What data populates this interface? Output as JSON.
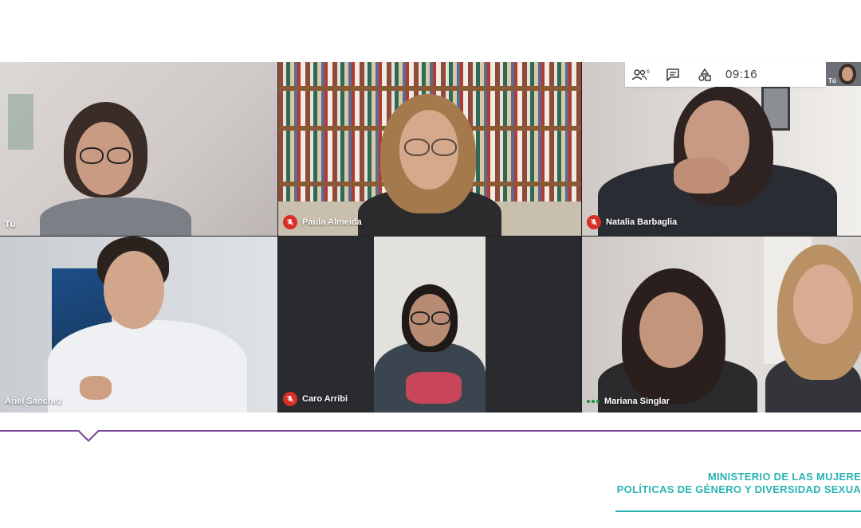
{
  "meeting": {
    "clock": "09:16",
    "self_label": "Tú"
  },
  "toolbar": {
    "people_badge": "6",
    "icons": [
      "people-icon",
      "chat-icon",
      "activities-icon"
    ]
  },
  "participants": [
    {
      "name": "Tú",
      "muted": false
    },
    {
      "name": "Paula Almeida",
      "muted": true
    },
    {
      "name": "Natalia Barbaglia",
      "muted": true
    },
    {
      "name": "Ariel Sanchez",
      "muted": false
    },
    {
      "name": "Caro Arribi",
      "muted": true
    },
    {
      "name": "Mariana Singlar",
      "muted": false,
      "speaking": true
    }
  ],
  "footer": {
    "ministry_line1": "MINISTERIO DE LAS MUJERE",
    "ministry_line2": "POLÍTICAS DE GÉNERO Y DIVERSIDAD SEXUA"
  },
  "colors": {
    "mute_red": "#d93025",
    "speaking_green": "#1e8e3e",
    "footer_purple": "#7b4a9c",
    "ministry_teal": "#2bb3b3"
  }
}
